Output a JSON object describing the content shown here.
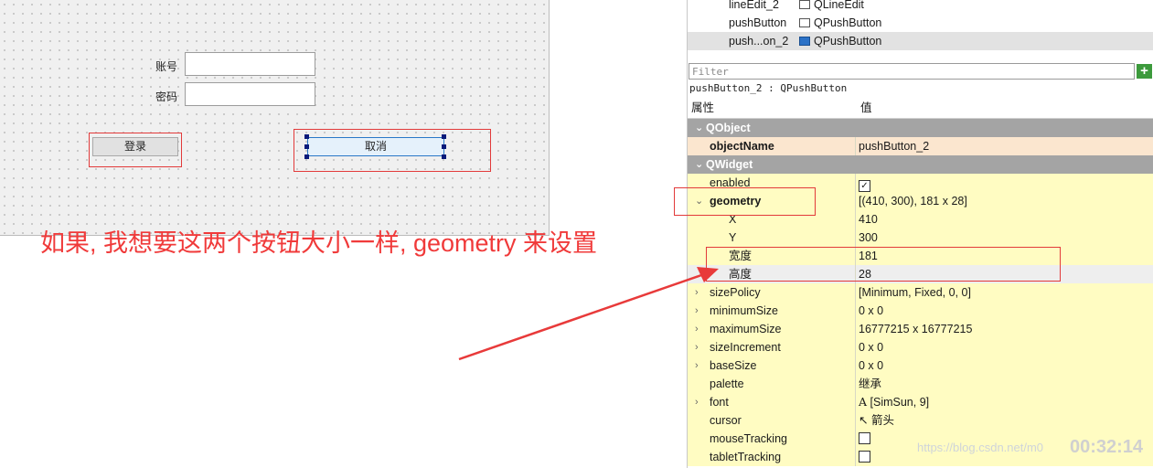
{
  "form": {
    "account_label": "账号",
    "password_label": "密码",
    "login_button": "登录",
    "cancel_button": "取消"
  },
  "annotation": "如果, 我想要这两个按钮大小一样, geometry 来设置",
  "object_inspector": {
    "rows": [
      {
        "name": "lineEdit_2",
        "class": "QLineEdit"
      },
      {
        "name": "pushButton",
        "class": "QPushButton"
      },
      {
        "name": "push...on_2",
        "class": "QPushButton"
      }
    ]
  },
  "property_editor": {
    "filter_placeholder": "Filter",
    "add_button": "+",
    "object_caption": "pushButton_2 : QPushButton",
    "header_property": "属性",
    "header_value": "值",
    "groups": {
      "qobject": "QObject",
      "qwidget": "QWidget"
    },
    "object_name": {
      "name": "objectName",
      "value": "pushButton_2"
    },
    "enabled": {
      "name": "enabled",
      "checked": true
    },
    "geometry": {
      "name": "geometry",
      "value": "[(410, 300), 181 x 28]"
    },
    "x": {
      "name": "X",
      "value": "410"
    },
    "y": {
      "name": "Y",
      "value": "300"
    },
    "width": {
      "name": "宽度",
      "value": "181"
    },
    "height": {
      "name": "高度",
      "value": "28"
    },
    "size_policy": {
      "name": "sizePolicy",
      "value": "[Minimum, Fixed, 0, 0]"
    },
    "minimum_size": {
      "name": "minimumSize",
      "value": "0 x 0"
    },
    "maximum_size": {
      "name": "maximumSize",
      "value": "16777215 x 16777215"
    },
    "size_increment": {
      "name": "sizeIncrement",
      "value": "0 x 0"
    },
    "base_size": {
      "name": "baseSize",
      "value": "0 x 0"
    },
    "palette": {
      "name": "palette",
      "value": "继承"
    },
    "font": {
      "name": "font",
      "value": "[SimSun, 9]",
      "icon": "A"
    },
    "cursor": {
      "name": "cursor",
      "value": "箭头",
      "icon": "↖"
    },
    "mouse_tracking": {
      "name": "mouseTracking",
      "checked": false
    },
    "tablet_tracking": {
      "name": "tabletTracking",
      "checked": false
    }
  },
  "watermark": "https://blog.csdn.net/m0",
  "timestamp": "00:32:14",
  "colors": {
    "annotation_red": "#f03a3a",
    "group_gray": "#a4a4a4",
    "row_yellow": "#fffcc2",
    "row_orange": "#fbe6cf"
  }
}
